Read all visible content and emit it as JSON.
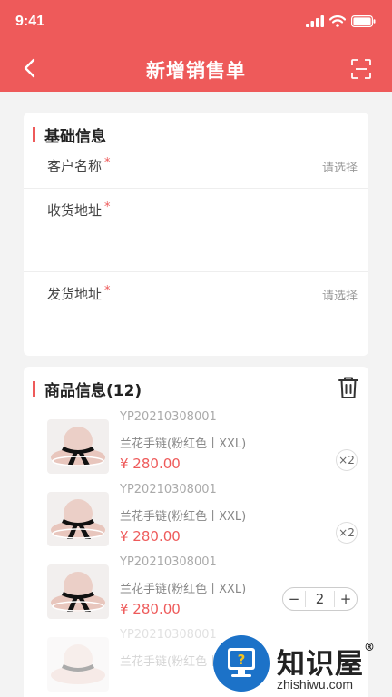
{
  "status_bar": {
    "time": "9:41"
  },
  "header": {
    "title": "新增销售单"
  },
  "basic_info": {
    "title": "基础信息",
    "fields": [
      {
        "label": "客户名称",
        "required": "*",
        "value": "请选择"
      },
      {
        "label": "收货地址",
        "required": "*",
        "value": ""
      },
      {
        "label": "发货地址",
        "required": "*",
        "value": "请选择"
      }
    ]
  },
  "product_info": {
    "title": "商品信息(12)",
    "items": [
      {
        "code": "YP20210308001",
        "name": "兰花手链(粉红色丨XXL)",
        "price": "¥ 280.00",
        "qty": "×2"
      },
      {
        "code": "YP20210308001",
        "name": "兰花手链(粉红色丨XXL)",
        "price": "¥ 280.00",
        "qty": "×2"
      },
      {
        "code": "YP20210308001",
        "name": "兰花手链(粉红色丨XXL)",
        "price": "¥ 280.00",
        "stepper": {
          "minus": "−",
          "value": "2",
          "plus": "+"
        }
      },
      {
        "code": "YP20210308001",
        "name": "兰花手链(粉红色丨XXL)"
      }
    ]
  },
  "watermark": {
    "brand": "知识屋",
    "reg": "®",
    "url": "zhishiwu.com",
    "badge_glyph": "?"
  },
  "colors": {
    "accent": "#ee5a5a",
    "background": "#f3f3f3",
    "watermark_blue": "#1c72c8"
  }
}
